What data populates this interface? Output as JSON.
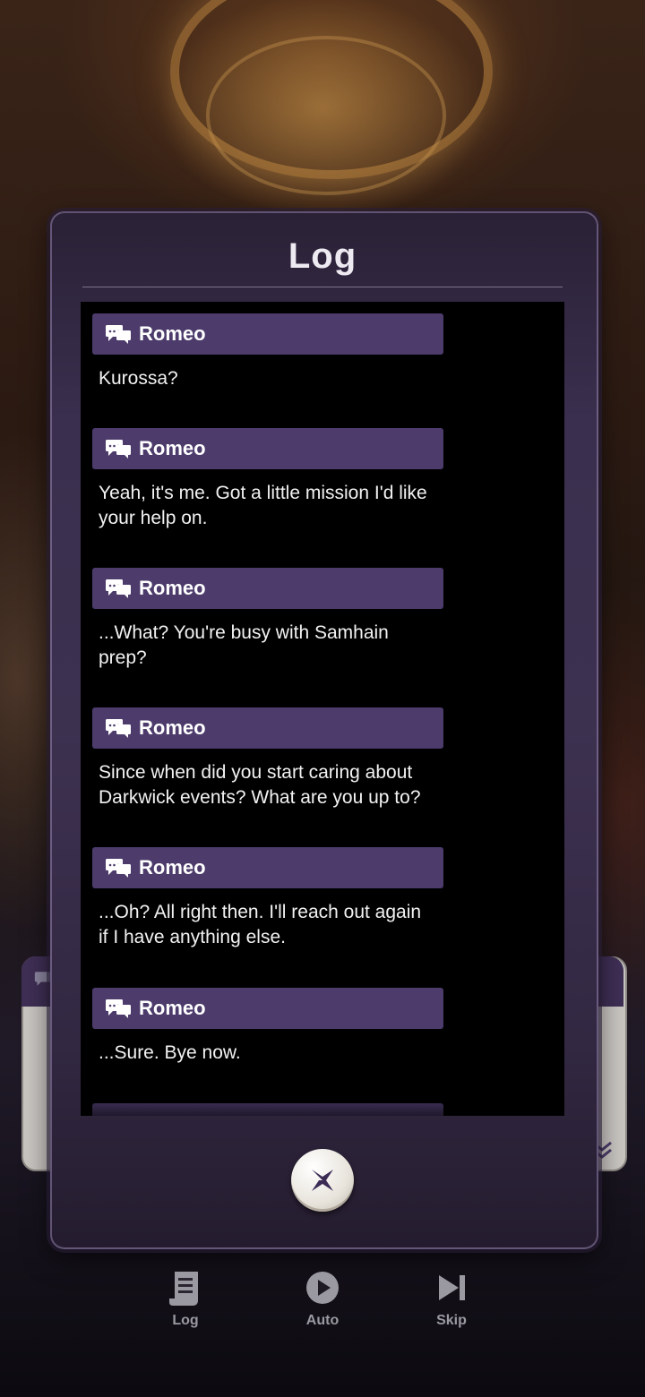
{
  "log_panel": {
    "title": "Log",
    "entries": [
      {
        "speaker": "Romeo",
        "text": "Kurossa?"
      },
      {
        "speaker": "Romeo",
        "text": "Yeah, it's me. Got a little mission I'd like your help on."
      },
      {
        "speaker": "Romeo",
        "text": "...What? You're busy with Samhain prep?"
      },
      {
        "speaker": "Romeo",
        "text": "Since when did you start caring about Darkwick events? What are you up to?"
      },
      {
        "speaker": "Romeo",
        "text": "...Oh? All right then. I'll reach out again if I have anything else."
      },
      {
        "speaker": "Romeo",
        "text": "...Sure. Bye now."
      }
    ],
    "close_icon": "close-x-icon"
  },
  "toolbar": {
    "log_label": "Log",
    "auto_label": "Auto",
    "skip_label": "Skip"
  },
  "colors": {
    "speaker_bar": "#4c3b6b",
    "panel": "#3d3150",
    "list_background": "#000000",
    "toolbar_text": "#9a98a0"
  }
}
